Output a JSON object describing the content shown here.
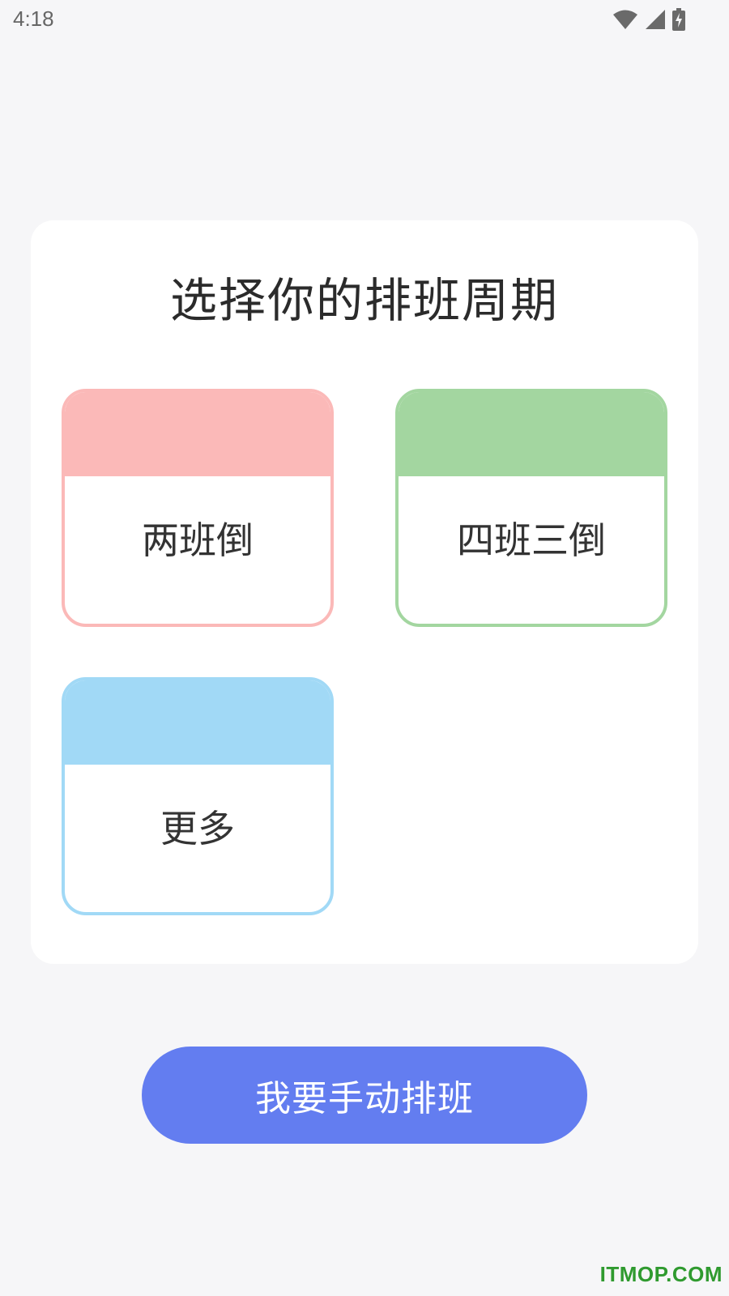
{
  "status_bar": {
    "time": "4:18",
    "icons": [
      "wifi-icon",
      "signal-icon",
      "battery-charging-icon"
    ]
  },
  "panel": {
    "title": "选择你的排班周期",
    "options": [
      {
        "label": "两班倒",
        "accent_color": "#fbb9b8"
      },
      {
        "label": "四班三倒",
        "accent_color": "#a3d6a0"
      },
      {
        "label": "更多",
        "accent_color": "#a1d9f6"
      }
    ]
  },
  "manual_button": {
    "label": "我要手动排班",
    "color": "#637df0"
  },
  "watermark": "ITMOP.COM"
}
